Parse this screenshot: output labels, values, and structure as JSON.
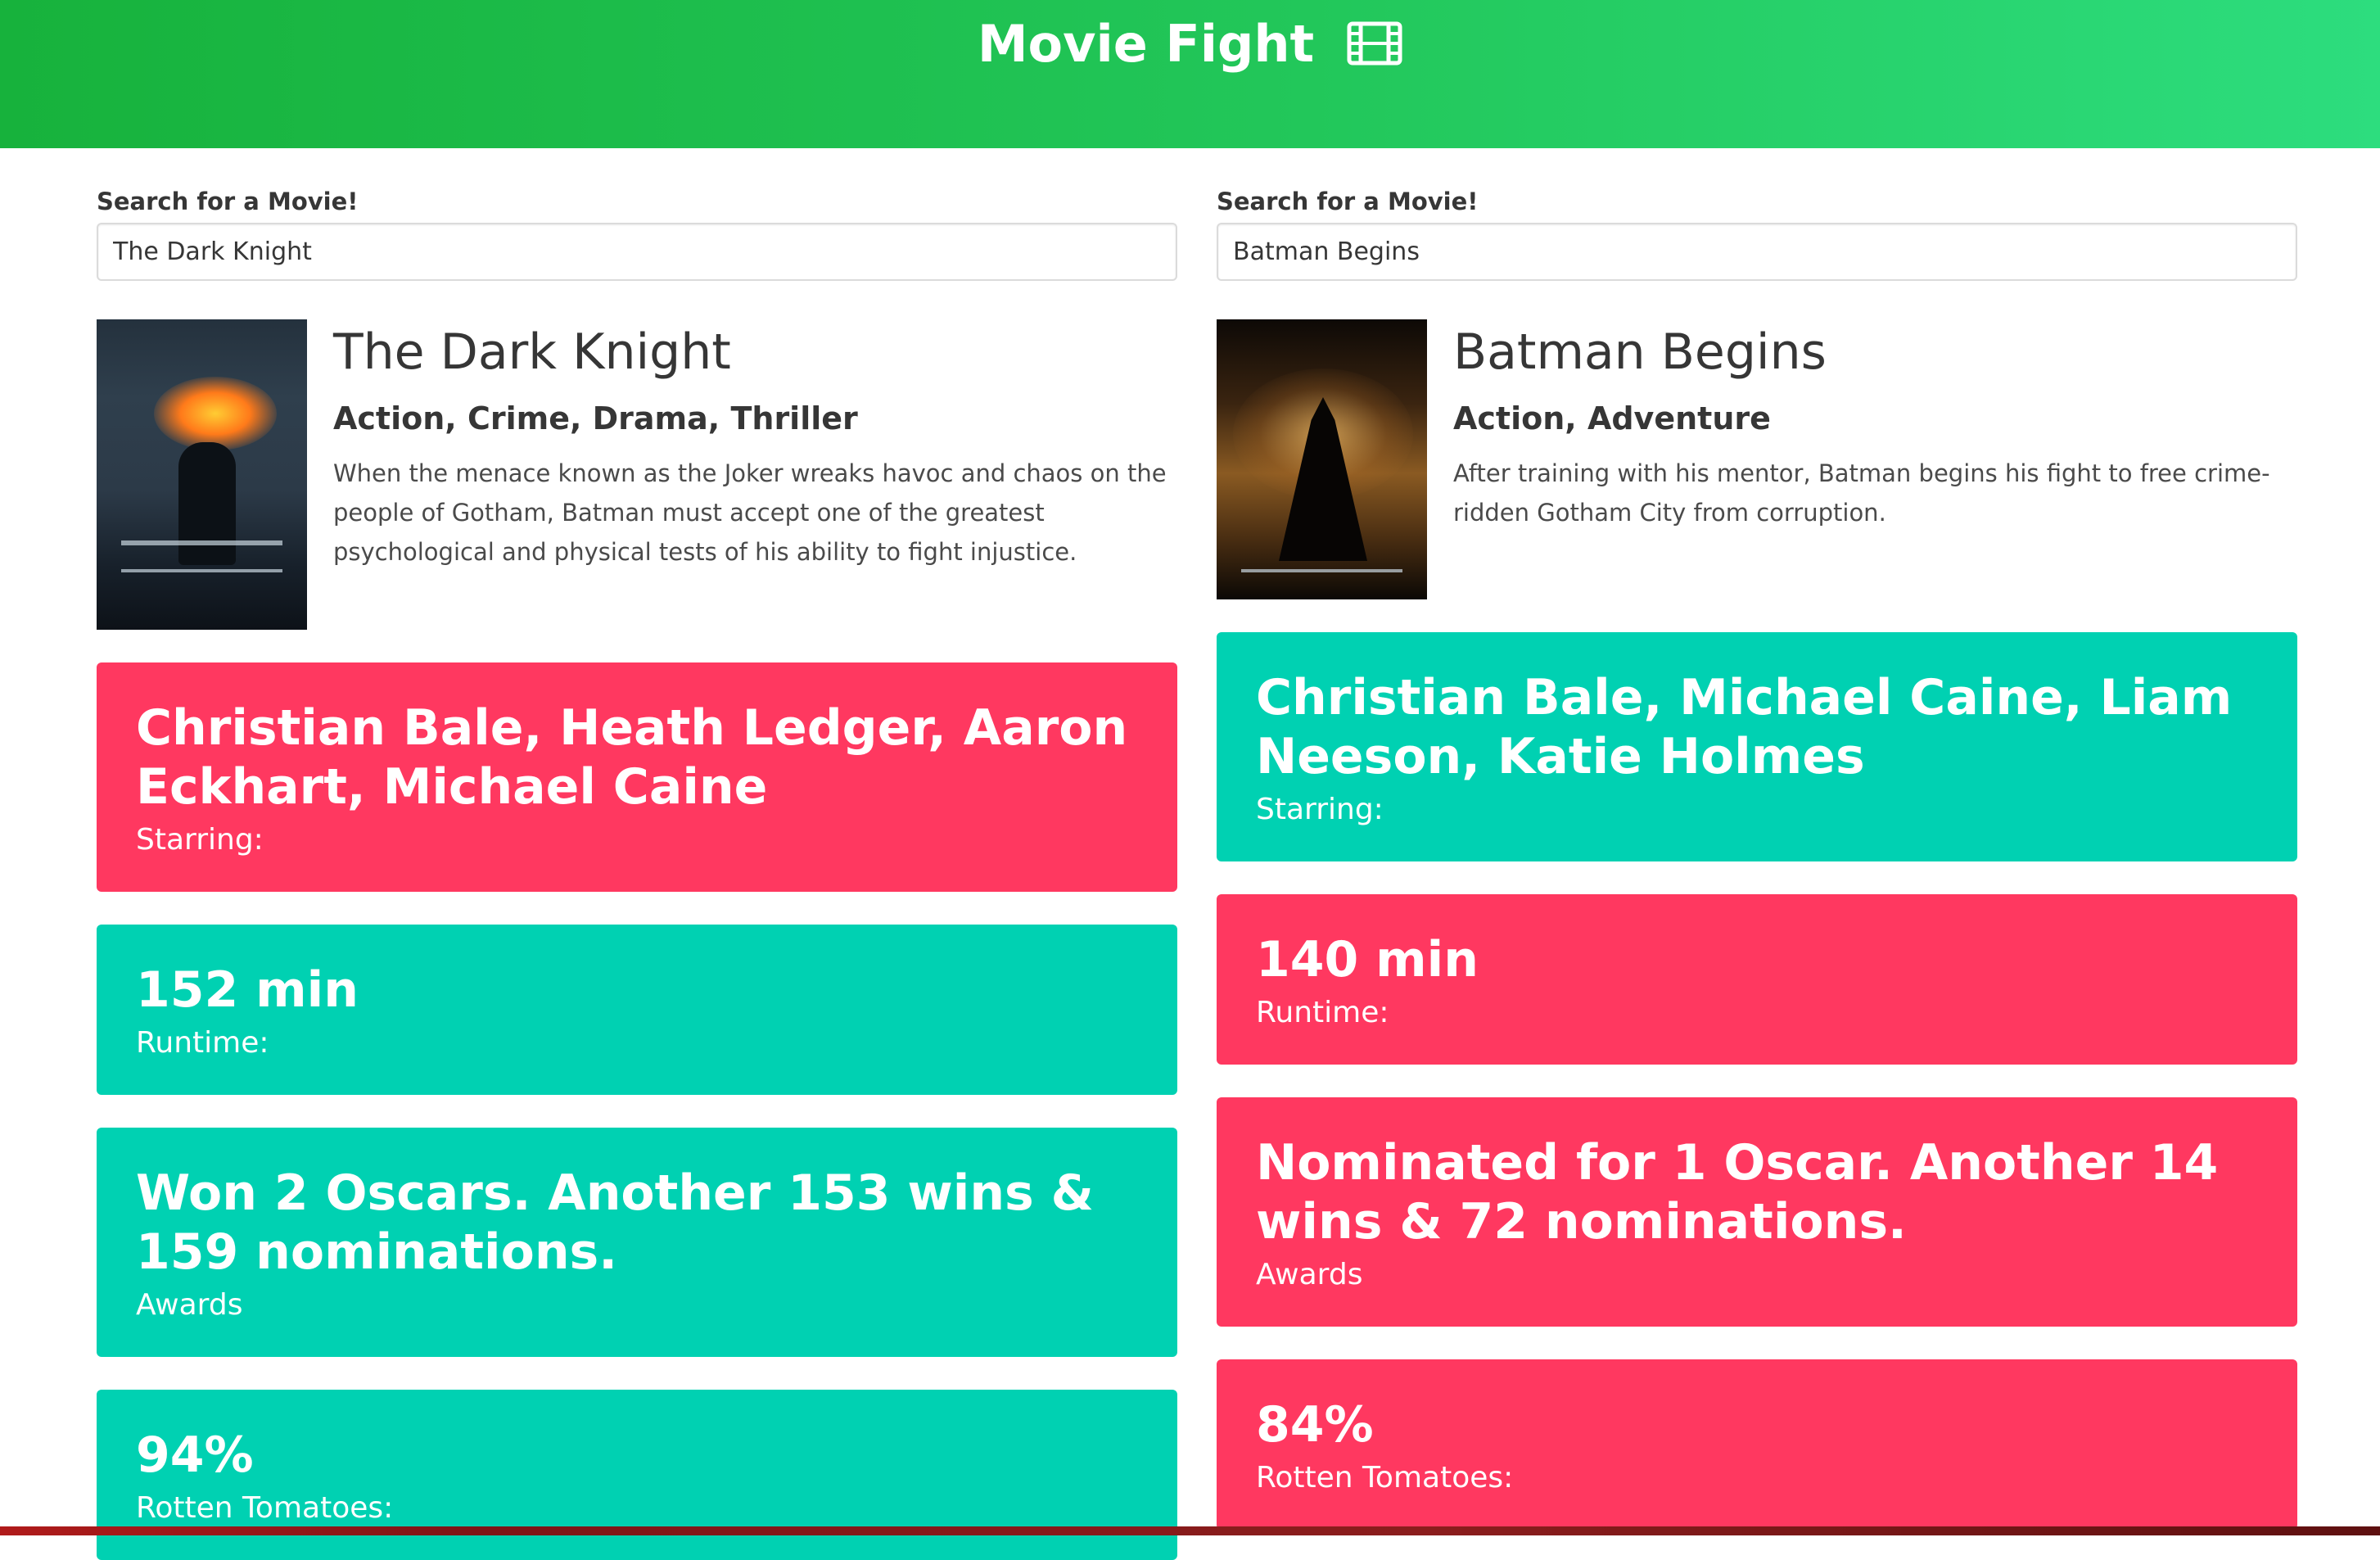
{
  "header": {
    "title": "Movie Fight",
    "icon": "film-icon"
  },
  "left": {
    "search_label": "Search for a Movie!",
    "search_value": "The Dark Knight",
    "movie": {
      "title": "The Dark Knight",
      "genre": "Action, Crime, Drama, Thriller",
      "plot": "When the menace known as the Joker wreaks havoc and chaos on the people of Gotham, Batman must accept one of the greatest psychological and physical tests of his ability to fight injustice."
    },
    "stats": [
      {
        "value": "Christian Bale, Heath Ledger, Aaron Eckhart, Michael Caine",
        "label": "Starring:",
        "color": "#ff3860"
      },
      {
        "value": "152 min",
        "label": "Runtime:",
        "color": "#00d1b2"
      },
      {
        "value": "Won 2 Oscars. Another 153 wins & 159 nominations.",
        "label": "Awards",
        "color": "#00d1b2"
      },
      {
        "value": "94%",
        "label": "Rotten Tomatoes:",
        "color": "#00d1b2"
      }
    ]
  },
  "right": {
    "search_label": "Search for a Movie!",
    "search_value": "Batman Begins",
    "movie": {
      "title": "Batman Begins",
      "genre": "Action, Adventure",
      "plot": "After training with his mentor, Batman begins his fight to free crime-ridden Gotham City from corruption."
    },
    "stats": [
      {
        "value": "Christian Bale, Michael Caine, Liam Neeson, Katie Holmes",
        "label": "Starring:",
        "color": "#00d1b2"
      },
      {
        "value": "140 min",
        "label": "Runtime:",
        "color": "#ff3860"
      },
      {
        "value": "Nominated for 1 Oscar. Another 14 wins & 72 nominations.",
        "label": "Awards",
        "color": "#ff3860"
      },
      {
        "value": "84%",
        "label": "Rotten Tomatoes:",
        "color": "#ff3860"
      }
    ]
  },
  "colors": {
    "winner": "#00d1b2",
    "loser": "#ff3860",
    "header_start": "#17b23c",
    "header_end": "#2ddd7e"
  }
}
